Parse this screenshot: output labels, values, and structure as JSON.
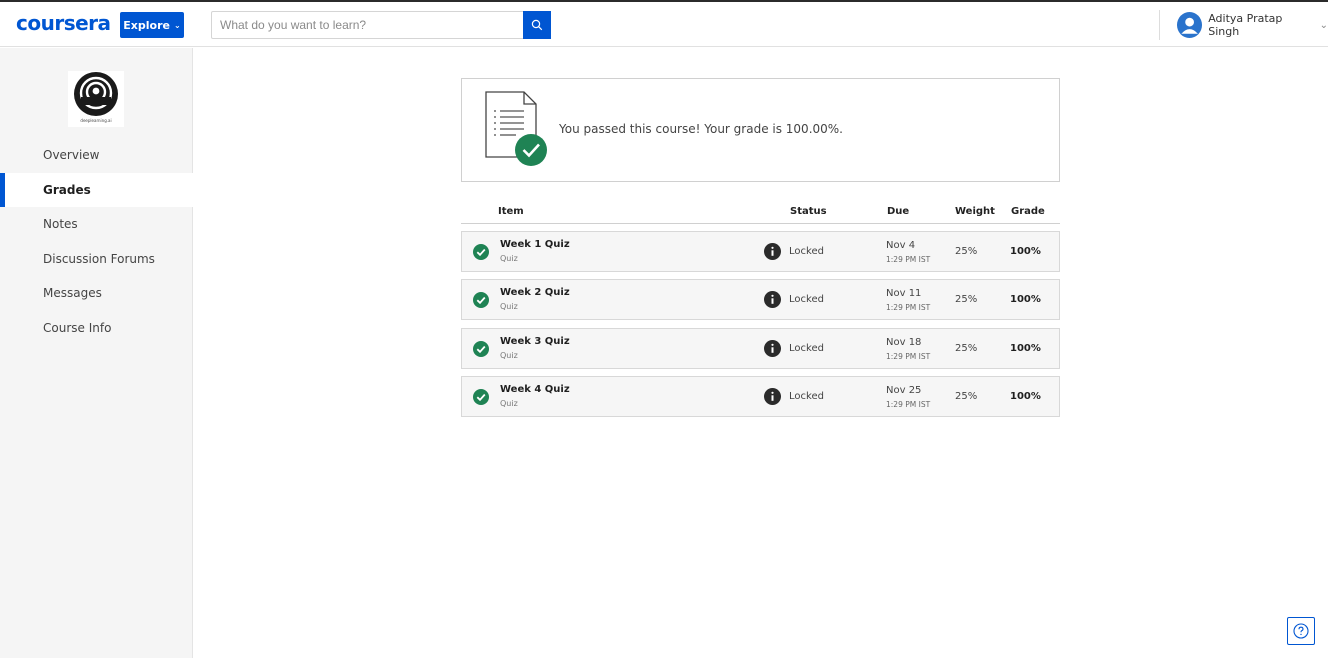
{
  "header": {
    "logo_text": "coursera",
    "explore_label": "Explore",
    "search_placeholder": "What do you want to learn?",
    "user_name": "Aditya Pratap Singh"
  },
  "sidebar": {
    "course_logo_caption": "deeplearning.ai",
    "items": [
      {
        "label": "Overview"
      },
      {
        "label": "Grades"
      },
      {
        "label": "Notes"
      },
      {
        "label": "Discussion Forums"
      },
      {
        "label": "Messages"
      },
      {
        "label": "Course Info"
      }
    ]
  },
  "banner": {
    "message": "You passed this course! Your grade is 100.00%."
  },
  "table": {
    "headers": {
      "item": "Item",
      "status": "Status",
      "due": "Due",
      "weight": "Weight",
      "grade": "Grade"
    },
    "rows": [
      {
        "name": "Week 1 Quiz",
        "type": "Quiz",
        "status": "Locked",
        "due_date": "Nov 4",
        "due_time": "1:29 PM IST",
        "weight": "25%",
        "grade": "100%"
      },
      {
        "name": "Week 2 Quiz",
        "type": "Quiz",
        "status": "Locked",
        "due_date": "Nov 11",
        "due_time": "1:29 PM IST",
        "weight": "25%",
        "grade": "100%"
      },
      {
        "name": "Week 3 Quiz",
        "type": "Quiz",
        "status": "Locked",
        "due_date": "Nov 18",
        "due_time": "1:29 PM IST",
        "weight": "25%",
        "grade": "100%"
      },
      {
        "name": "Week 4 Quiz",
        "type": "Quiz",
        "status": "Locked",
        "due_date": "Nov 25",
        "due_time": "1:29 PM IST",
        "weight": "25%",
        "grade": "100%"
      }
    ]
  },
  "colors": {
    "brand": "#0056d2",
    "success": "#1f8354",
    "info_icon": "#2b2b2b"
  },
  "icons": {
    "search": "search-icon",
    "help": "help-icon",
    "check": "check-circle-icon",
    "info": "info-icon",
    "document": "document-check-icon"
  }
}
